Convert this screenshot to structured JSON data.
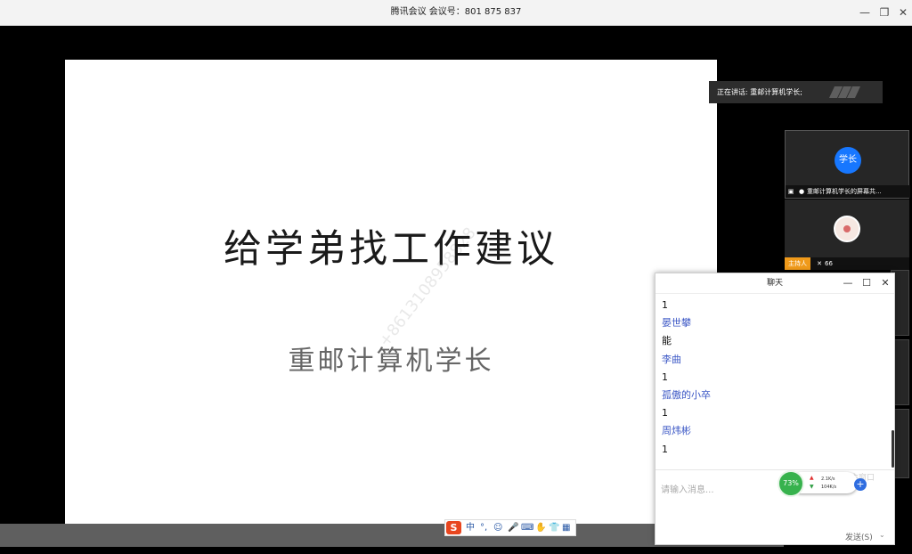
{
  "window": {
    "title": "腾讯会议 会议号：801 875 837",
    "minimize": "—",
    "restore": "❐",
    "close": "✕"
  },
  "slide": {
    "title": "给学弟找工作建议",
    "subtitle": "重邮计算机学长",
    "watermark": "+8613108958828"
  },
  "speaking": {
    "text": "正在讲话: 重邮计算机学长;"
  },
  "participants": [
    {
      "avatar_text": "学长",
      "label": "重邮计算机学长的屏幕共...",
      "icons": [
        "screen-share-icon",
        "mic-icon"
      ]
    },
    {
      "avatar_text": "",
      "host_badge": "主持人",
      "label": "66",
      "icons": [
        "mic-muted-icon"
      ]
    }
  ],
  "chat": {
    "title": "聊天",
    "messages": [
      {
        "type": "body",
        "text": "1"
      },
      {
        "type": "name",
        "text": "晏世攀"
      },
      {
        "type": "body",
        "text": "能"
      },
      {
        "type": "name",
        "text": "李曲"
      },
      {
        "type": "body",
        "text": "1"
      },
      {
        "type": "name",
        "text": "孤傲的小卒"
      },
      {
        "type": "body",
        "text": "1"
      },
      {
        "type": "name",
        "text": "周炜彬"
      },
      {
        "type": "body",
        "text": "1"
      }
    ],
    "input_placeholder": "请输入消息...",
    "back_to_main": "回主窗口",
    "send_label": "发送(S)",
    "send_dropdown": "⌄"
  },
  "net_widget": {
    "percent": "73%",
    "upload": "2.1K/s",
    "download": "104K/s",
    "accent": "#37b24d"
  },
  "ime": {
    "logo": "S",
    "items": [
      "中",
      "°,",
      "☺",
      "🎤",
      "⌨",
      "✋",
      "👕",
      "▦"
    ]
  },
  "colors": {
    "chat_name": "#3a56c5",
    "host_badge": "#f09a1a",
    "avatar_blue": "#1777ff"
  }
}
